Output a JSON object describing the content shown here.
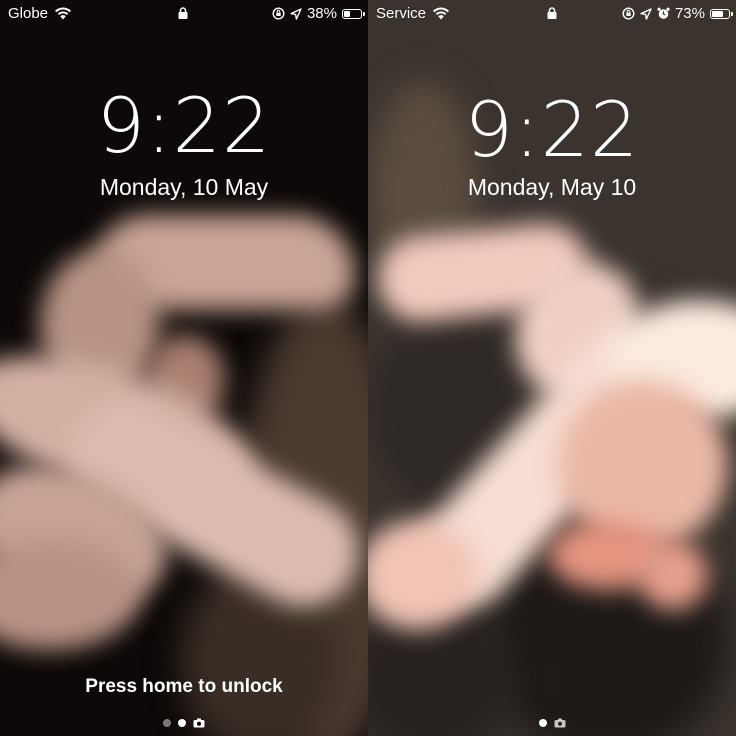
{
  "left_screen": {
    "carrier": "Globe",
    "battery_percent": "38%",
    "battery_level": 0.38,
    "time": "9:22",
    "date": "Monday, 10 May",
    "unlock_hint": "Press home to unlock",
    "page_dots": 2
  },
  "right_screen": {
    "carrier": "Service",
    "battery_percent": "73%",
    "battery_level": 0.73,
    "time": "9:22",
    "date": "Monday, May 10",
    "page_dots": 1
  }
}
